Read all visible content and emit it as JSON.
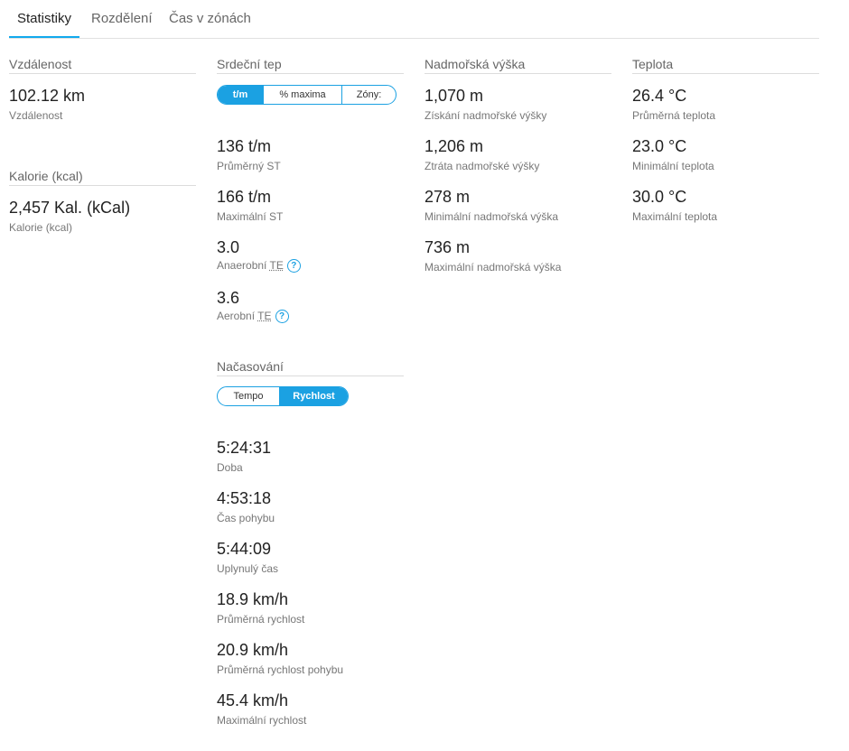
{
  "tabs": [
    {
      "label": "Statistiky"
    },
    {
      "label": "Rozdělení"
    },
    {
      "label": "Čas v zónách"
    }
  ],
  "distance": {
    "title": "Vzdálenost",
    "stats": [
      {
        "value": "102.12 km",
        "label": "Vzdálenost"
      }
    ]
  },
  "calories": {
    "title": "Kalorie (kcal)",
    "stats": [
      {
        "value": "2,457 Kal. (kCal)",
        "label": "Kalorie (kcal)"
      }
    ]
  },
  "heart_rate": {
    "title": "Srdeční tep",
    "toggle": [
      {
        "label": "t/m",
        "selected": true
      },
      {
        "label": "% maxima",
        "selected": false
      },
      {
        "label": "Zóny:",
        "selected": false
      }
    ],
    "stats": [
      {
        "value": "136 t/m",
        "label": "Průměrný ST"
      },
      {
        "value": "166 t/m",
        "label": "Maximální ST"
      },
      {
        "value": "3.0",
        "label_prefix": "Anaerobní",
        "label_abbr": "TE"
      },
      {
        "value": "3.6",
        "label_prefix": "Aerobní",
        "label_abbr": "TE"
      }
    ],
    "help_glyph": "?"
  },
  "timing": {
    "title": "Načasování",
    "toggle": [
      {
        "label": "Tempo",
        "selected": false
      },
      {
        "label": "Rychlost",
        "selected": true
      }
    ],
    "stats": [
      {
        "value": "5:24:31",
        "label": "Doba"
      },
      {
        "value": "4:53:18",
        "label": "Čas pohybu"
      },
      {
        "value": "5:44:09",
        "label": "Uplynulý čas"
      },
      {
        "value": "18.9 km/h",
        "label": "Průměrná rychlost"
      },
      {
        "value": "20.9 km/h",
        "label": "Průměrná rychlost pohybu"
      },
      {
        "value": "45.4 km/h",
        "label": "Maximální rychlost"
      }
    ]
  },
  "elevation": {
    "title": "Nadmořská výška",
    "stats": [
      {
        "value": "1,070 m",
        "label": "Získání nadmořské výšky"
      },
      {
        "value": "1,206 m",
        "label": "Ztráta nadmořské výšky"
      },
      {
        "value": "278 m",
        "label": "Minimální nadmořská výška"
      },
      {
        "value": "736 m",
        "label": "Maximální nadmořská výška"
      }
    ]
  },
  "temperature": {
    "title": "Teplota",
    "stats": [
      {
        "value": "26.4 °C",
        "label": "Průměrná teplota"
      },
      {
        "value": "23.0 °C",
        "label": "Minimální teplota"
      },
      {
        "value": "30.0 °C",
        "label": "Maximální teplota"
      }
    ]
  },
  "colors": {
    "accent": "#1ba1e2",
    "active_tab_underline": "#11a9ed"
  }
}
